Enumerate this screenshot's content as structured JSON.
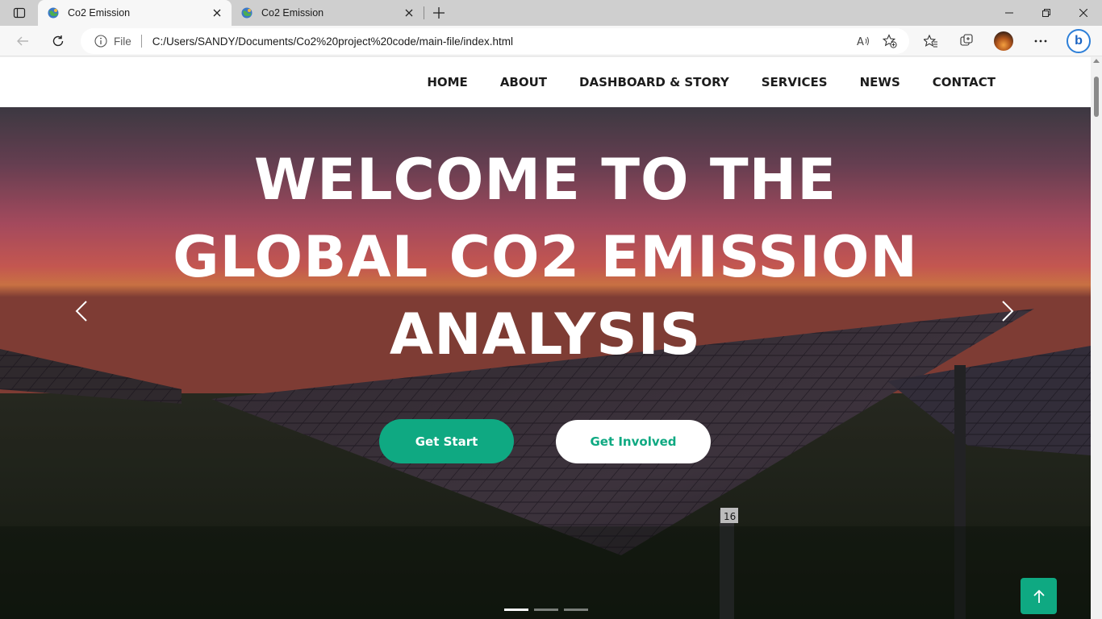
{
  "browser": {
    "tabs": [
      {
        "title": "Co2 Emission",
        "active": true
      },
      {
        "title": "Co2 Emission",
        "active": false
      }
    ],
    "address": {
      "scheme_label": "File",
      "url": "C:/Users/SANDY/Documents/Co2%20project%20code/main-file/index.html"
    },
    "icons": {
      "tab_actions": "tab-actions-icon",
      "new_tab": "plus-icon",
      "back": "back-arrow-icon",
      "refresh": "refresh-icon",
      "info": "info-icon",
      "read_aloud": "read-aloud-icon",
      "add_favorite": "add-favorite-icon",
      "favorites": "favorites-icon",
      "collections": "collections-icon",
      "more": "more-icon",
      "bing": "bing-icon"
    }
  },
  "nav": {
    "links": [
      "HOME",
      "ABOUT",
      "DASHBOARD & STORY",
      "SERVICES",
      "NEWS",
      "CONTACT"
    ]
  },
  "hero": {
    "title_lines": [
      "WELCOME TO THE",
      "GLOBAL CO2 EMISSION",
      "ANALYSIS"
    ],
    "primary_button": "Get Start",
    "secondary_button": "Get Involved",
    "slide_count": 3,
    "active_slide": 0,
    "panel_label": "16"
  },
  "colors": {
    "accent": "#0fa982",
    "nav_text": "#1c1c1c",
    "hero_text": "#ffffff"
  }
}
